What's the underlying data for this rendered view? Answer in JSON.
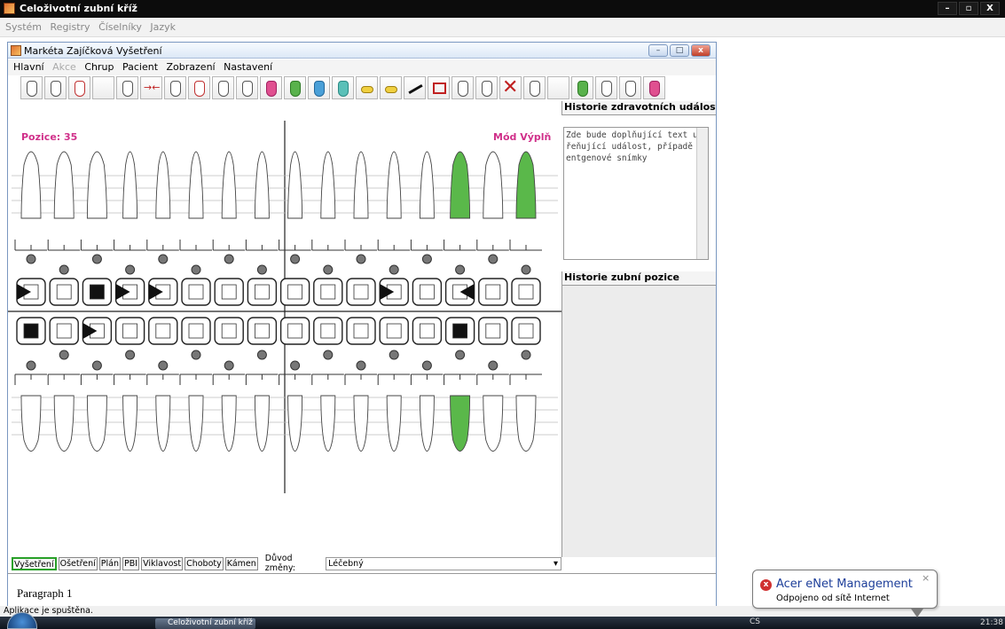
{
  "outer_window": {
    "title": "Celoživotní zubní kříž",
    "menu": [
      "Systém",
      "Registry",
      "Číselníky",
      "Jazyk"
    ],
    "controls": [
      "–",
      "▫",
      "X"
    ]
  },
  "inner_window": {
    "title": "Markéta Zajíčková Vyšetření",
    "menu": [
      {
        "label": "Hlavní",
        "enabled": true
      },
      {
        "label": "Akce",
        "enabled": false
      },
      {
        "label": "Chrup",
        "enabled": true
      },
      {
        "label": "Pacient",
        "enabled": true
      },
      {
        "label": "Zobrazení",
        "enabled": true
      },
      {
        "label": "Nastavení",
        "enabled": true
      }
    ]
  },
  "toolbar": {
    "icons": [
      "tooth-outline-icon",
      "tooth-root-icon",
      "tooth-red-icon",
      "blank-icon",
      "implant-icon",
      "bridge-arrow-icon",
      "root-canal-icon",
      "root-red-icon",
      "tooth-dark-icon",
      "tooth-double-icon",
      "tooth-purple-icon",
      "tooth-green-icon",
      "tooth-blue-icon",
      "tooth-teal-icon",
      "filling-yellow-icon",
      "tooth-yellow-icon",
      "line-icon",
      "box-icon",
      "tooth-grid-icon",
      "tooth-gray-icon",
      "extract-x-icon",
      "tooth-wide-icon",
      "blank2-icon",
      "tooth-green2-icon",
      "tooth-plus-icon",
      "plus-tooth-icon",
      "tooth-pink-icon"
    ]
  },
  "chart": {
    "position_label": "Pozice: 35",
    "mode_label": "Mód Výplň",
    "upper_surfaces": [
      "dark-left",
      "empty",
      "dark-center",
      "dark-left",
      "dark-left",
      "empty",
      "empty",
      "empty",
      "empty",
      "empty",
      "empty",
      "dark-left",
      "empty",
      "dark-right",
      "empty",
      "empty"
    ],
    "lower_surfaces": [
      "dark-center",
      "empty",
      "dark-left",
      "empty",
      "empty",
      "empty",
      "empty",
      "empty",
      "empty",
      "empty",
      "empty",
      "empty",
      "empty",
      "dark-center",
      "empty",
      "empty"
    ],
    "upper_green": [
      13,
      15
    ],
    "lower_green": [
      13
    ]
  },
  "history": {
    "title": "Historie zdravotních událostí",
    "text": "Zde bude doplňující text upřeňující událost, případě rentgenové snímky",
    "position_title": "Historie zubní pozice"
  },
  "tabs": {
    "items": [
      {
        "label": "Vyšetření",
        "active": true
      },
      {
        "label": "Ošetření",
        "active": false
      },
      {
        "label": "Plán",
        "active": false
      },
      {
        "label": "PBI",
        "active": false
      },
      {
        "label": "Viklavost",
        "active": false
      },
      {
        "label": "Choboty",
        "active": false
      },
      {
        "label": "Kámen",
        "active": false
      }
    ],
    "reason_label": "Důvod změny:",
    "reason_value": "Léčebný"
  },
  "paragraph": "Paragraph 1",
  "status": "Aplikace je spuštěna.",
  "taskbar": {
    "window_button": "Celoživotní zubní kříž",
    "lang": "CS",
    "clock": "21:38"
  },
  "balloon": {
    "title": "Acer eNet Management",
    "text": "Odpojeno od sítě Internet"
  }
}
